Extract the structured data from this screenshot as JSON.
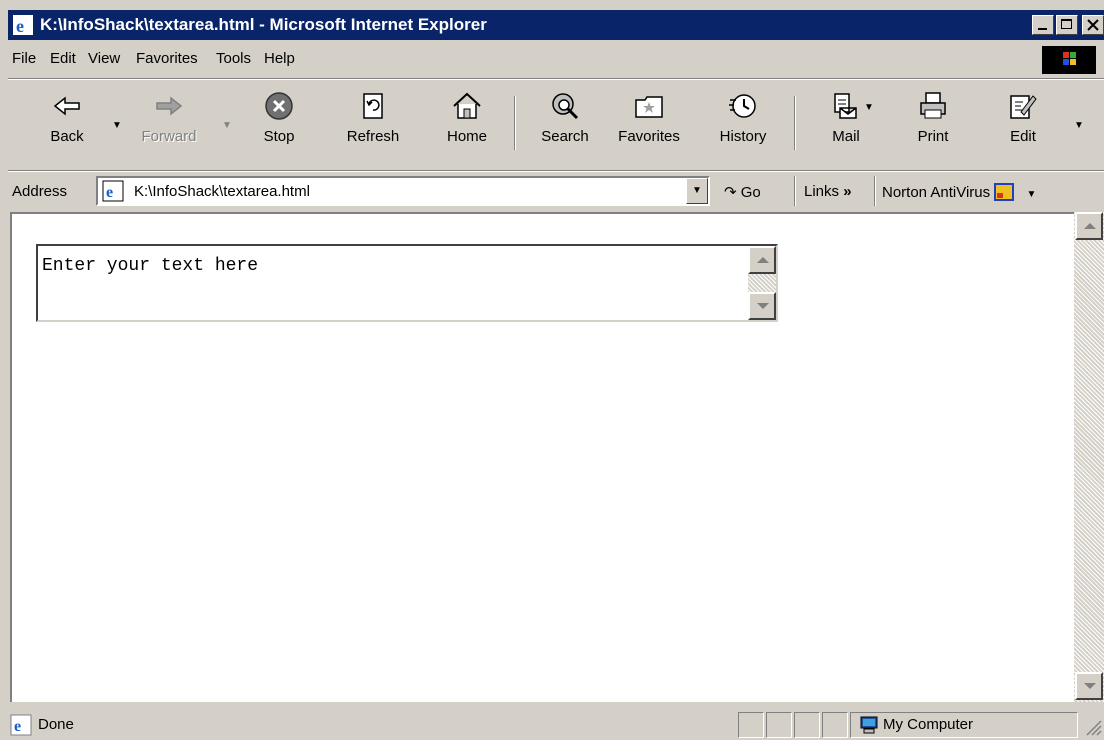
{
  "window": {
    "title": "K:\\InfoShack\\textarea.html - Microsoft Internet Explorer"
  },
  "menu": {
    "file": "File",
    "edit": "Edit",
    "view": "View",
    "favorites": "Favorites",
    "tools": "Tools",
    "help": "Help"
  },
  "toolbar": {
    "back": "Back",
    "forward": "Forward",
    "stop": "Stop",
    "refresh": "Refresh",
    "home": "Home",
    "search": "Search",
    "favorites": "Favorites",
    "history": "History",
    "mail": "Mail",
    "print": "Print",
    "edit": "Edit"
  },
  "address_bar": {
    "label": "Address",
    "value": "K:\\InfoShack\\textarea.html",
    "go": "Go",
    "links": "Links",
    "links_chevron": "»",
    "norton": "Norton AntiVirus"
  },
  "page": {
    "textarea_value": "Enter your text here"
  },
  "status": {
    "text": "Done",
    "zone": "My Computer"
  },
  "colors": {
    "titlebar": "#0a246a",
    "chrome": "#d4d0c8"
  }
}
